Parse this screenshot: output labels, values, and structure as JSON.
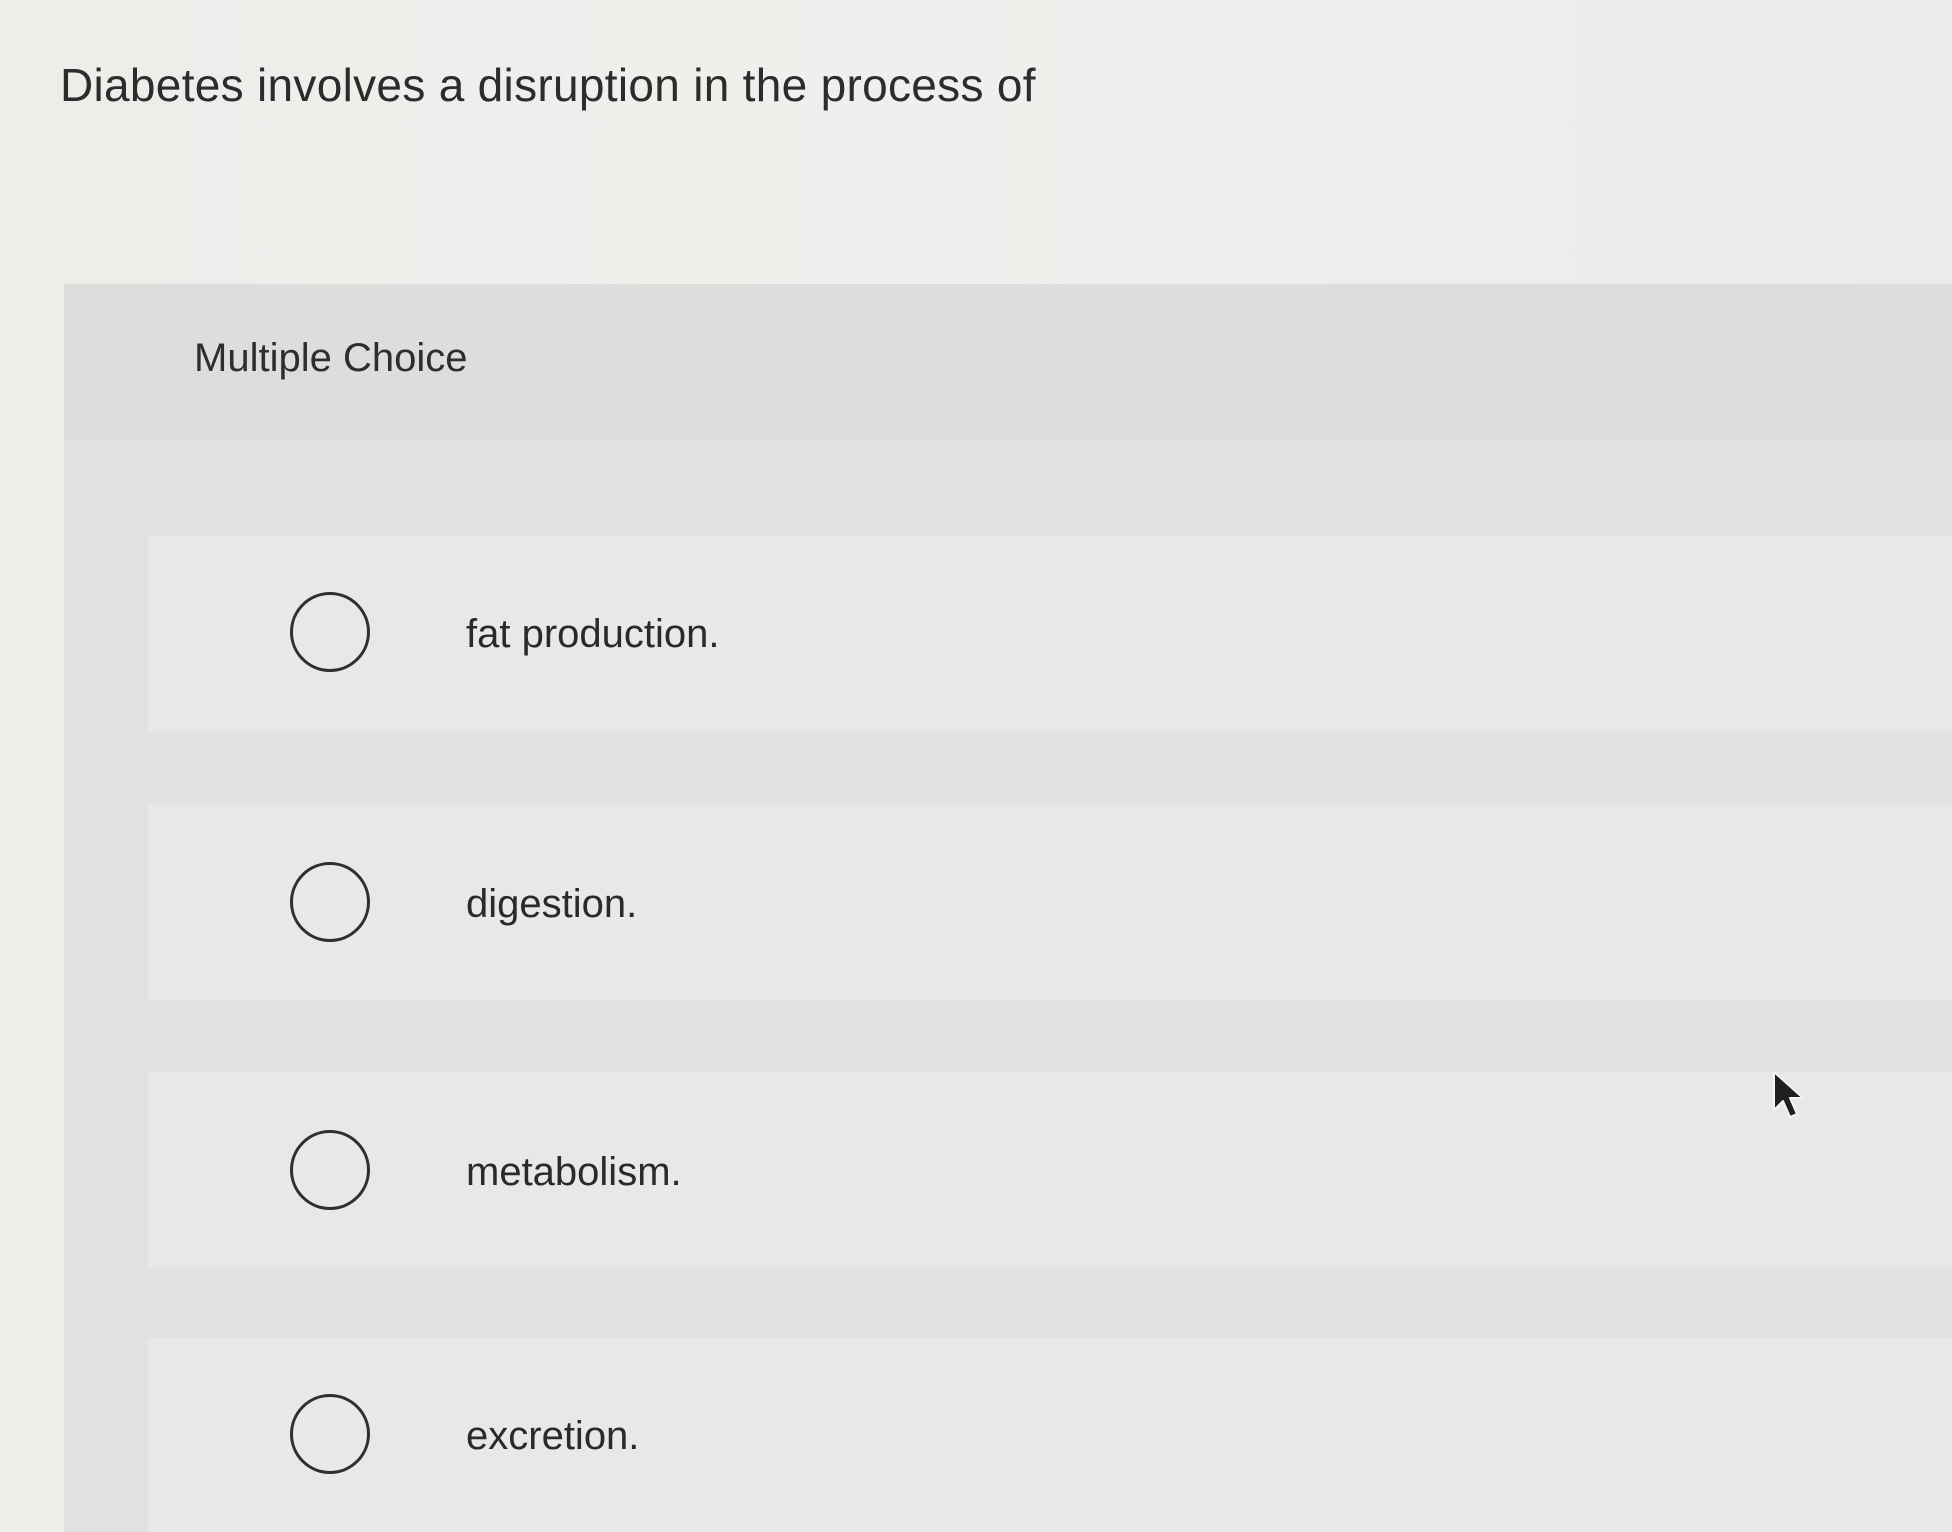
{
  "question": {
    "text": "Diabetes involves a disruption in the process of"
  },
  "choice_panel": {
    "label": "Multiple Choice",
    "options": [
      {
        "label": "fat production.",
        "selected": false
      },
      {
        "label": "digestion.",
        "selected": false
      },
      {
        "label": "metabolism.",
        "selected": false
      },
      {
        "label": "excretion.",
        "selected": false
      }
    ]
  },
  "icons": {
    "radio": "radio-circle-icon",
    "cursor": "mouse-pointer-icon"
  },
  "colors": {
    "text": "#2b2b2b",
    "page_background": "#ecedea",
    "panel_background": "#e2e3e1",
    "radio_border": "#2f2f2f"
  }
}
